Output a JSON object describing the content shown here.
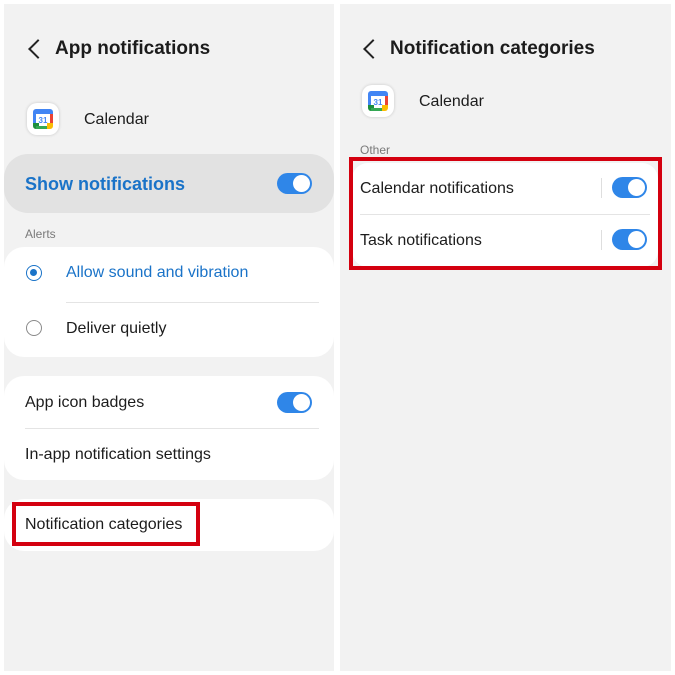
{
  "left_screen": {
    "header": {
      "title": "App notifications"
    },
    "app": {
      "name": "Calendar",
      "icon": "google-calendar-icon",
      "icon_text": "31"
    },
    "show_notifications": {
      "label": "Show notifications",
      "enabled": true
    },
    "alerts": {
      "section_label": "Alerts",
      "options": [
        {
          "label": "Allow sound and vibration",
          "selected": true
        },
        {
          "label": "Deliver quietly",
          "selected": false
        }
      ]
    },
    "badges": {
      "label": "App icon badges",
      "enabled": true
    },
    "in_app": {
      "label": "In-app notification settings"
    },
    "categories": {
      "label": "Notification categories"
    }
  },
  "right_screen": {
    "header": {
      "title": "Notification categories"
    },
    "app": {
      "name": "Calendar",
      "icon": "google-calendar-icon",
      "icon_text": "31"
    },
    "section_label": "Other",
    "items": [
      {
        "label": "Calendar notifications",
        "enabled": true
      },
      {
        "label": "Task notifications",
        "enabled": true
      }
    ]
  },
  "colors": {
    "accent_blue": "#1a73c8",
    "toggle_on": "#2f86e8",
    "highlight_red": "#d4000f",
    "background": "#f2f2f2"
  }
}
